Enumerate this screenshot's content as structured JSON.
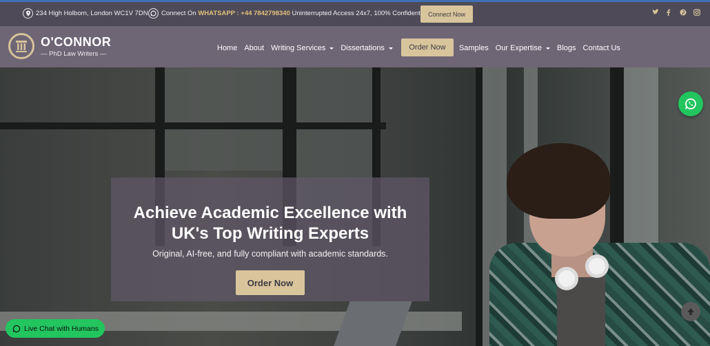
{
  "topbar": {
    "address": "234 High Holborn, London WC1V 7DN",
    "connect_prefix": "Connect On",
    "whatsapp_label": "WHATSAPP : +44 7842798340",
    "connect_suffix": "Uninterrupted Access 24x7, 100% Confidential.",
    "connect_button": "Connect Now",
    "social_icons": [
      "twitter-icon",
      "facebook-icon",
      "pinterest-icon",
      "instagram-icon"
    ]
  },
  "brand": {
    "name": "O'CONNOR",
    "tagline": "— PhD Law Writers —"
  },
  "nav": {
    "items": [
      {
        "label": "Home"
      },
      {
        "label": "About"
      },
      {
        "label": "Writing Services"
      },
      {
        "label": "Dissertations"
      },
      {
        "label": "Order Now"
      },
      {
        "label": "Samples"
      },
      {
        "label": "Our Expertise"
      },
      {
        "label": "Blogs"
      },
      {
        "label": "Contact Us"
      }
    ]
  },
  "hero": {
    "title_line1": "Achieve Academic Excellence with",
    "title_line2": "UK's Top Writing Experts",
    "subtitle": "Original, AI-free, and fully compliant with academic standards.",
    "cta": "Order Now"
  },
  "widgets": {
    "live_chat": "Live Chat with Humans"
  },
  "colors": {
    "topbar_bg": "#4e4a58",
    "nav_bg": "#6e6575",
    "accent_gold": "#d8c59c",
    "whatsapp_green": "#22c55e"
  }
}
